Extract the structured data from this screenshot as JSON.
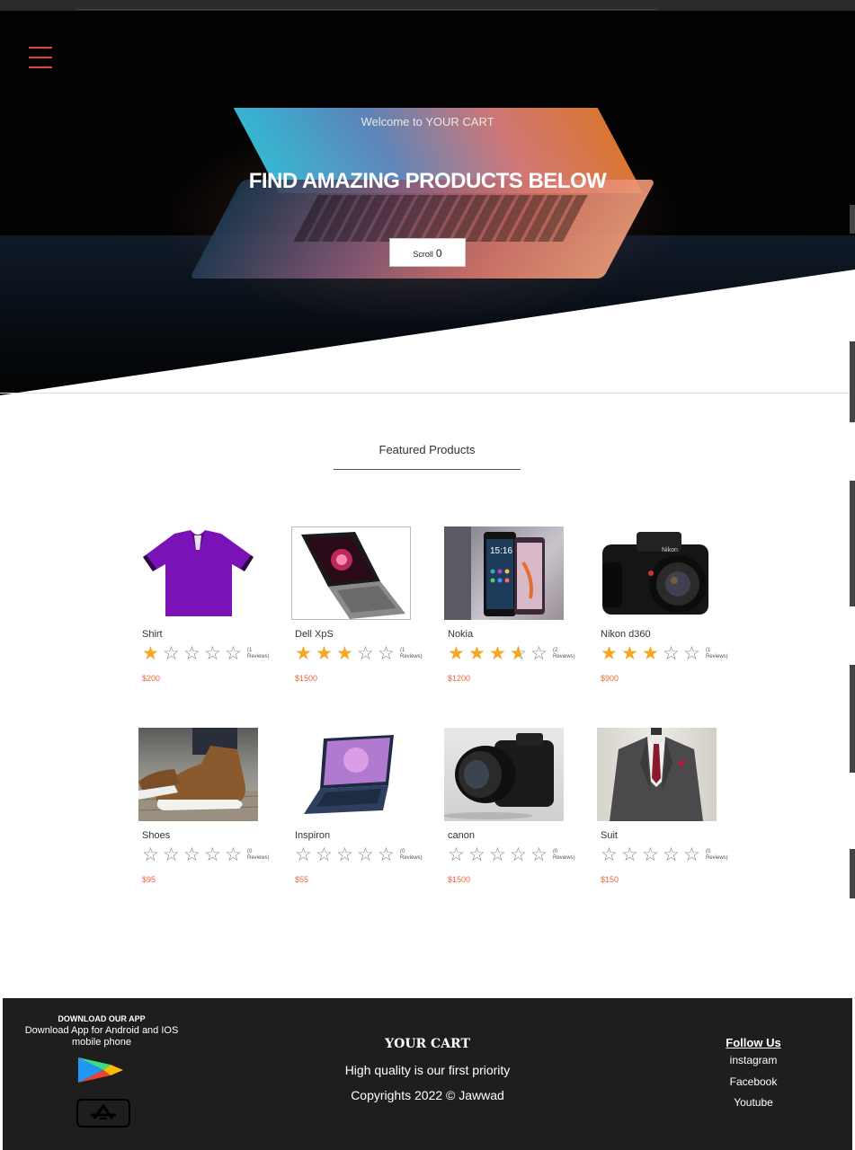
{
  "hero": {
    "welcome": "Welcome to YOUR CART",
    "headline": "FIND AMAZING PRODUCTS BELOW",
    "scroll_label": "Scroll",
    "scroll_icon": "0"
  },
  "featured_title": "Featured Products",
  "products": [
    {
      "name": "Shirt",
      "stars": 1,
      "reviews": "(1 Reviews)",
      "price": "$200"
    },
    {
      "name": "Dell XpS",
      "stars": 3,
      "reviews": "(1 Reviews)",
      "price": "$1500"
    },
    {
      "name": "Nokia",
      "stars": 3.5,
      "reviews": "(2 Reviews)",
      "price": "$1200"
    },
    {
      "name": "Nikon d360",
      "stars": 3,
      "reviews": "(1 Reviews)",
      "price": "$900"
    },
    {
      "name": "Shoes",
      "stars": 0,
      "reviews": "(0 Reviews)",
      "price": "$95"
    },
    {
      "name": "Inspiron",
      "stars": 0,
      "reviews": "(0 Reviews)",
      "price": "$55"
    },
    {
      "name": "canon",
      "stars": 0,
      "reviews": "(0 Reviews)",
      "price": "$1500"
    },
    {
      "name": "Suit",
      "stars": 0,
      "reviews": "(0 Reviews)",
      "price": "$150"
    }
  ],
  "footer": {
    "download_title": "DOWNLOAD OUR APP",
    "download_text": "Download App for Android and IOS mobile phone",
    "brand": "YOUR CART",
    "tagline": "High quality is our first priority",
    "copyright": "Copyrights 2022 © Jawwad",
    "follow_title": "Follow Us",
    "links": [
      "instagram",
      "Facebook",
      "Youtube"
    ]
  },
  "colors": {
    "accent": "#d94a3a",
    "star": "#f5a623",
    "price": "#e8663c",
    "footer_bg": "#1e1e1e"
  }
}
